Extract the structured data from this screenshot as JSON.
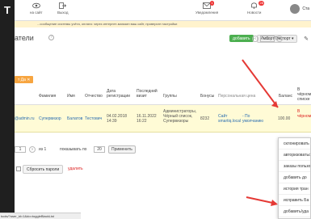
{
  "sidebar": {
    "logo": "T"
  },
  "topbar": {
    "to_site": "на сайт",
    "exit": "Выход",
    "notifications": {
      "label": "Уведомления",
      "count": "1"
    },
    "news": {
      "label": "Новости",
      "count": "28"
    },
    "user_short": "Ста"
  },
  "notice": {
    "text": "...сообщение системы учёта, оплата: через интернет-магазин ваш сайт, проверьте настройки"
  },
  "header": {
    "title": "атели",
    "help": "?",
    "add_button": "добавить",
    "import_export": "Импорт/Экспорт ▾"
  },
  "pager_top": {
    "current": "1"
  },
  "filter_chip": {
    "label": "т Да ✕"
  },
  "table": {
    "headers": {
      "lastname": "Фамилия",
      "firstname": "Имя",
      "patronymic": "Отчество",
      "reg_date": "Дата регистрации",
      "last_visit": "Последний визит",
      "groups": "Группы",
      "bonuses": "Бонусы",
      "personal_price": "Персональная цена",
      "balance": "Баланс",
      "blacklist": "В чёрном списке"
    },
    "row": {
      "email": "@admin.ru",
      "lastname": "Супервизор",
      "firstname": "Балатов",
      "patronymic": "Тестович",
      "reg_date": "04.02.2018 14:39",
      "last_visit": "16.11.2022 16:22",
      "groups": "Администраторы, Чёрный список, Супервизоры",
      "bonuses": "8232",
      "site": "Сайт smartiq.local",
      "personal_price": "- По умолчанию",
      "balance": "100.00",
      "blacklist": "В чёрном"
    }
  },
  "pager_bottom": {
    "first": "1",
    "total": "из 1",
    "show_label": "показывать по",
    "per_page": "20",
    "apply": "Применить"
  },
  "actions": {
    "reset_passwords": "Сбросить пароли",
    "delete": "удалить"
  },
  "dropdown": {
    "items": [
      "склонировать",
      "авторизоваться",
      "заказы пользоват",
      "добавить до",
      "история тран",
      "исправить Ба",
      "добавить/уда"
    ]
  },
  "statusbar": {
    "url": "tools/?user_id=1&do=toggleBlackList"
  },
  "colors": {
    "sidebar": "#1f1f1f",
    "highlight_row": "#fffbd6",
    "accent_green": "#4caf50",
    "chip_orange": "#f7a540",
    "arrow_red": "#e53935"
  }
}
